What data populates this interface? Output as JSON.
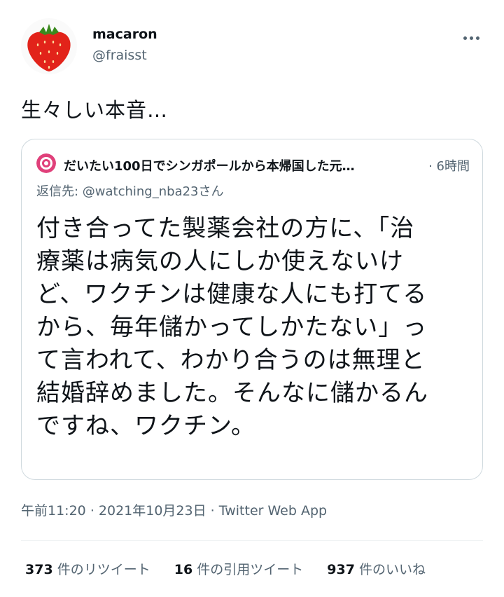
{
  "author": {
    "name": "macaron",
    "handle": "@fraisst"
  },
  "tweet": {
    "text": "生々しい本音…"
  },
  "quote": {
    "author_name": "だいたい100日でシンガポールから本帰国した元…",
    "time": "· 6時間",
    "reply_to": "返信先: @watching_nba23さん",
    "text": "付き合ってた製薬会社の方に、「治\n療薬は病気の人にしか使えないけ\nど、ワクチンは健康な人にも打てる\nから、毎年儲かってしかたない」っ\nて言われて、わかり合うのは無理と\n結婚辞めました。そんなに儲かるん\nですね、ワクチン。"
  },
  "meta": {
    "time": "午前11:20",
    "date": "2021年10月23日",
    "source": "Twitter Web App",
    "sep": "·"
  },
  "stats": {
    "retweets_count": "373",
    "retweets_label": "件のリツイート",
    "quotes_count": "16",
    "quotes_label": "件の引用ツイート",
    "likes_count": "937",
    "likes_label": "件のいいね"
  },
  "icons": {
    "avatar": "strawberry-avatar",
    "quote_avatar": "pink-avatar",
    "more": "more-dots-icon"
  },
  "colors": {
    "text": "#0f1419",
    "secondary": "#536471",
    "border": "#cfd9de",
    "strawberry": "#e2231a"
  }
}
